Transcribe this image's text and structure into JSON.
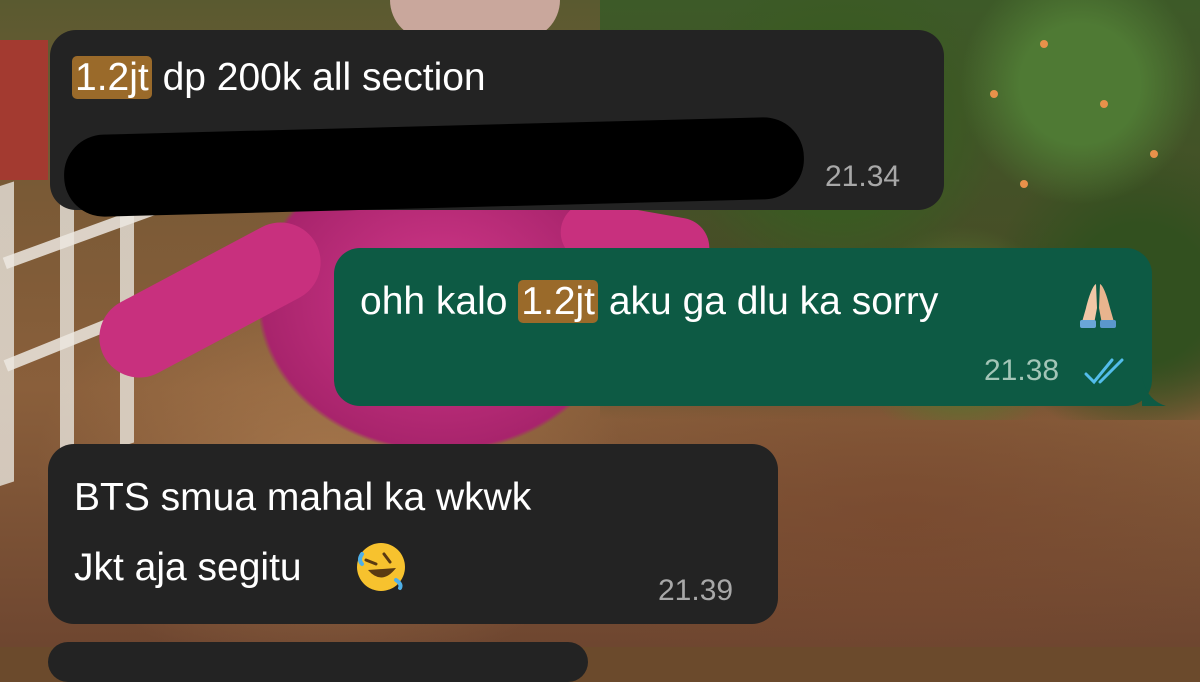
{
  "messages": [
    {
      "direction": "incoming",
      "highlight": "1.2jt",
      "text_rest": "dp 200k all section",
      "redacted_line": true,
      "time": "21.34"
    },
    {
      "direction": "outgoing",
      "text_before": "ohh kalo",
      "highlight": "1.2jt",
      "text_after": "aku ga dlu ka sorry",
      "emoji": "folded-hands",
      "time": "21.38",
      "status": "read"
    },
    {
      "direction": "incoming",
      "line1": "BTS smua mahal ka wkwk",
      "line2": "Jkt aja segitu",
      "emoji": "rolling-on-floor-laughing",
      "time": "21.39"
    }
  ],
  "colors": {
    "incoming_bubble": "#232323",
    "outgoing_bubble": "#0d5a44",
    "highlight": "#9a6a2a",
    "read_ticks": "#53bdeb"
  }
}
